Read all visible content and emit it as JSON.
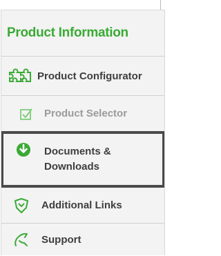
{
  "panel": {
    "title": "Product Information",
    "items": [
      {
        "label": "Product Configurator",
        "icon": "puzzle-icon"
      },
      {
        "label": "Product Selector",
        "icon": "checkbox-icon"
      },
      {
        "label_line1": "Documents &",
        "label_line2": "Downloads",
        "icon": "download-icon"
      },
      {
        "label": "Additional Links",
        "icon": "shield-link-icon"
      },
      {
        "label": "Support",
        "icon": "support-icon"
      }
    ]
  },
  "colors": {
    "accent": "#3aaa35",
    "text": "#3e3e3e",
    "muted": "#9a9a9a",
    "border": "#4a4a4a"
  }
}
